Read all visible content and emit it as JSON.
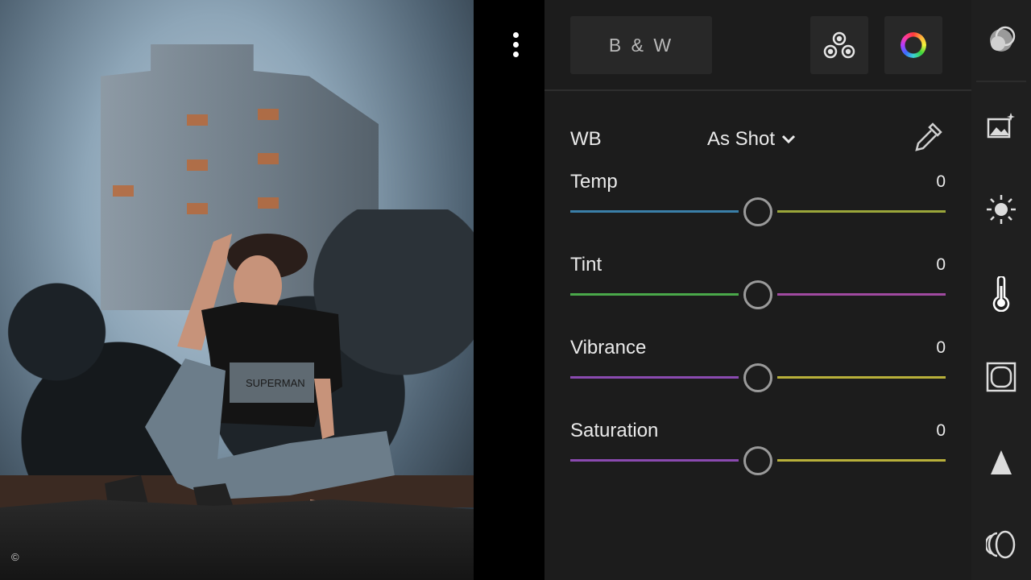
{
  "photo": {
    "copyright_symbol": "©",
    "shirt_text": "SUPERMAN"
  },
  "menu": {
    "icon": "more-vertical-icon"
  },
  "panel": {
    "bw_label": "B & W",
    "mixer_icon": "color-mix-icon",
    "grading_icon": "color-grading-wheel-icon",
    "wb": {
      "label": "WB",
      "value": "As Shot",
      "icon": "eyedropper-icon"
    },
    "sliders": [
      {
        "label": "Temp",
        "value": "0",
        "position": 0.5,
        "left_color": "#3a7fa8",
        "right_color": "#9aa63a"
      },
      {
        "label": "Tint",
        "value": "0",
        "position": 0.5,
        "left_color": "#4aa84a",
        "right_color": "#a04aa0"
      },
      {
        "label": "Vibrance",
        "value": "0",
        "position": 0.5,
        "left_color": "#8a4ab0",
        "right_color": "#b8b03a"
      },
      {
        "label": "Saturation",
        "value": "0",
        "position": 0.5,
        "left_color": "#8a4ab0",
        "right_color": "#b8b03a"
      }
    ]
  },
  "rail": {
    "items": [
      {
        "name": "presets",
        "icon": "presets-icon"
      },
      {
        "name": "auto",
        "icon": "auto-enhance-icon"
      },
      {
        "name": "light",
        "icon": "light-sun-icon"
      },
      {
        "name": "color",
        "icon": "color-thermometer-icon",
        "active": true
      },
      {
        "name": "effects",
        "icon": "effects-vignette-icon"
      },
      {
        "name": "detail",
        "icon": "detail-triangle-icon"
      },
      {
        "name": "optics",
        "icon": "optics-lens-icon"
      }
    ]
  },
  "colors": {
    "panel_bg": "#1c1c1c",
    "button_bg": "#282828",
    "rail_bg": "#1f1f1f",
    "accent_text": "#eaeaea"
  }
}
